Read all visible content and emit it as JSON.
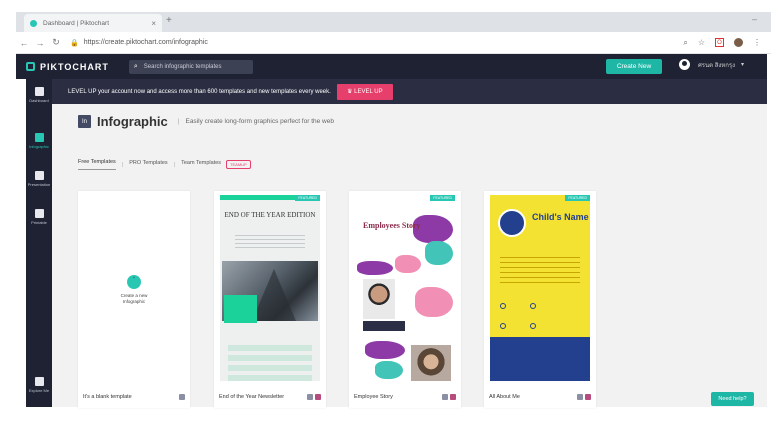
{
  "browser": {
    "tab_title": "Dashboard | Piktochart",
    "tab_close": "×",
    "new_tab": "+",
    "url": "https://create.piktochart.com/infographic"
  },
  "app": {
    "logo": "PIKTOCHART",
    "search_placeholder": "Search infographic templates",
    "create_new": "Create New",
    "user_name": "ศรนต สิงหกรุง"
  },
  "sidebar": {
    "items": [
      {
        "label": "Dashboard",
        "icon": "grid-icon"
      },
      {
        "label": "Infographic",
        "icon": "infographic-icon",
        "active": true
      },
      {
        "label": "Presentation",
        "icon": "presentation-icon"
      },
      {
        "label": "Printable",
        "icon": "printable-icon"
      },
      {
        "label": "Explore Me",
        "icon": "explore-icon"
      }
    ]
  },
  "banner": {
    "text": "LEVEL UP your account now and access more than 600 templates and new templates every week.",
    "button": "LEVEL UP"
  },
  "page": {
    "icon_text": "In",
    "title": "Infographic",
    "separator": "|",
    "subtitle": "Easily create long-form graphics perfect for the web"
  },
  "tabs": {
    "free": "Free Templates",
    "pro": "PRO Templates",
    "team": "Team Templates",
    "pipe": "|",
    "badge": "TEAMUP"
  },
  "cards": {
    "blank": {
      "line1": "Create a new",
      "line2": "Infographic",
      "label": "It's a blank template"
    },
    "c1": {
      "label": "End of the Year Newsletter",
      "featured": "FEATURED",
      "heading": "END OF THE YEAR EDITION"
    },
    "c2": {
      "label": "Employee Story",
      "featured": "FEATURED",
      "heading": "Employees Story"
    },
    "c3": {
      "label": "All About Me",
      "featured": "FEATURED",
      "heading": "Child's Name"
    }
  },
  "help": "Need help?",
  "colors": {
    "nav_dark": "#1f2233",
    "teal": "#1eb7a6",
    "pink": "#e63f6b"
  }
}
